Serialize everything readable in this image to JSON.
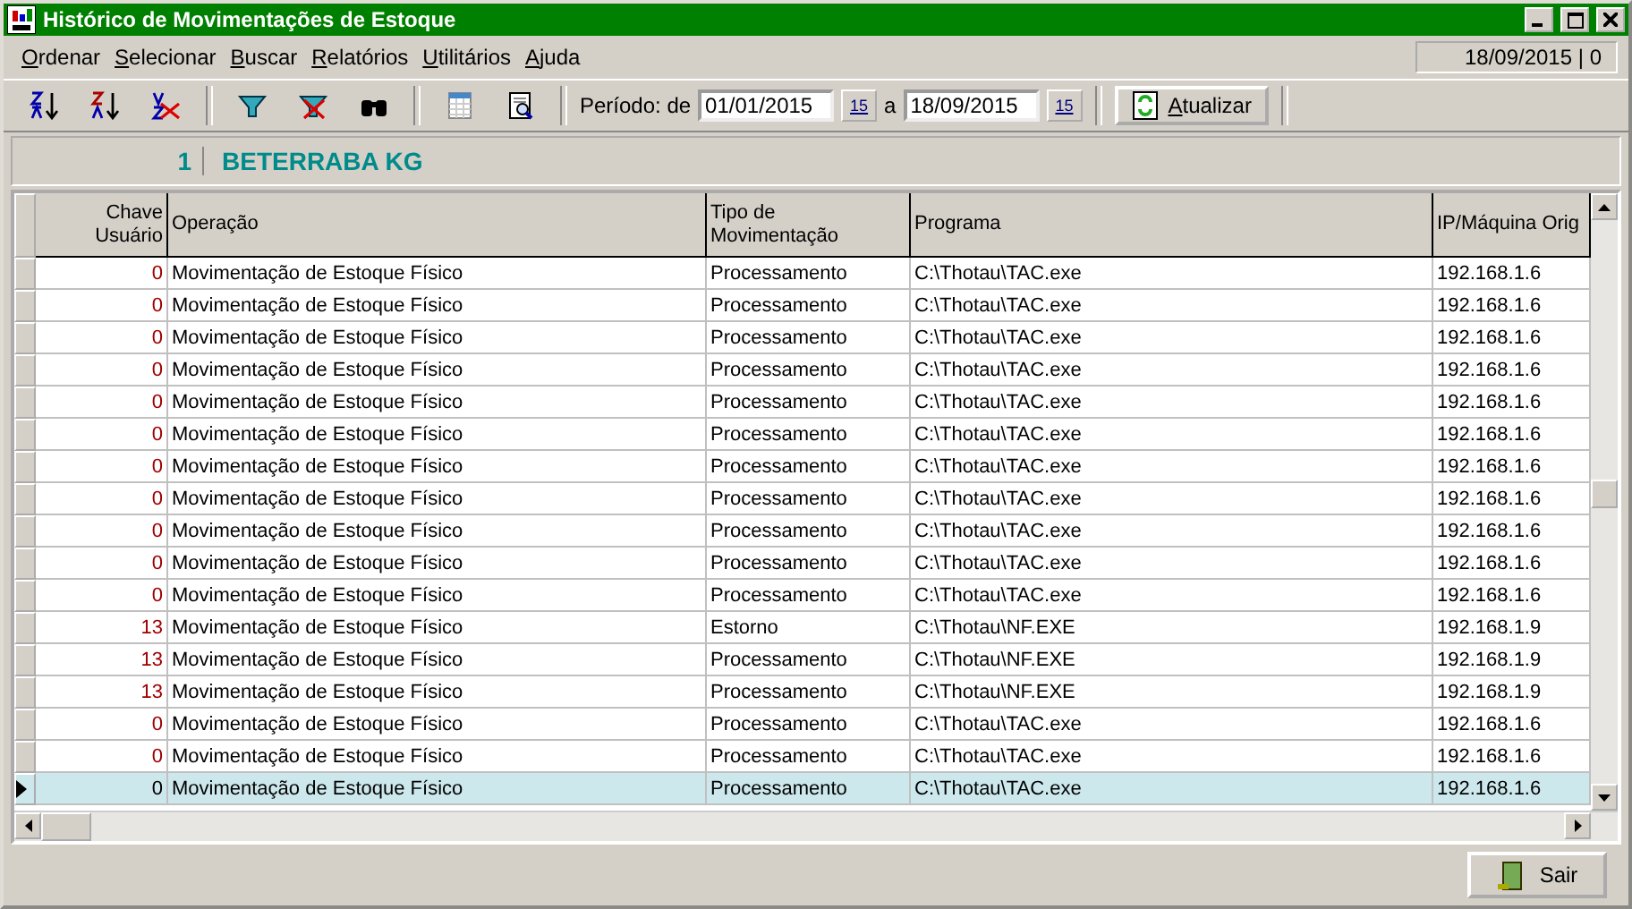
{
  "window": {
    "title": "Histórico de Movimentações de Estoque"
  },
  "menu": [
    "Ordenar",
    "Selecionar",
    "Buscar",
    "Relatórios",
    "Utilitários",
    "Ajuda"
  ],
  "status": "18/09/2015 | 0",
  "toolbar": {
    "period_label": "Período: de",
    "from": "01/01/2015",
    "from_calendar": "15",
    "to_calendar": "15",
    "to_label": "a",
    "to": "18/09/2015",
    "refresh": "Atualizar"
  },
  "product": {
    "code": "1",
    "name": "BETERRABA KG"
  },
  "table": {
    "columns": [
      "Chave Usuário",
      "Operação",
      "Tipo de Movimentação",
      "Programa",
      "IP/Máquina Orig"
    ],
    "rows": [
      {
        "user_key": "0",
        "operation": "Movimentação de Estoque Físico",
        "type": "Processamento",
        "program": "C:\\Thotau\\TAC.exe",
        "ip": "192.168.1.6",
        "selected": false
      },
      {
        "user_key": "0",
        "operation": "Movimentação de Estoque Físico",
        "type": "Processamento",
        "program": "C:\\Thotau\\TAC.exe",
        "ip": "192.168.1.6",
        "selected": false
      },
      {
        "user_key": "0",
        "operation": "Movimentação de Estoque Físico",
        "type": "Processamento",
        "program": "C:\\Thotau\\TAC.exe",
        "ip": "192.168.1.6",
        "selected": false
      },
      {
        "user_key": "0",
        "operation": "Movimentação de Estoque Físico",
        "type": "Processamento",
        "program": "C:\\Thotau\\TAC.exe",
        "ip": "192.168.1.6",
        "selected": false
      },
      {
        "user_key": "0",
        "operation": "Movimentação de Estoque Físico",
        "type": "Processamento",
        "program": "C:\\Thotau\\TAC.exe",
        "ip": "192.168.1.6",
        "selected": false
      },
      {
        "user_key": "0",
        "operation": "Movimentação de Estoque Físico",
        "type": "Processamento",
        "program": "C:\\Thotau\\TAC.exe",
        "ip": "192.168.1.6",
        "selected": false
      },
      {
        "user_key": "0",
        "operation": "Movimentação de Estoque Físico",
        "type": "Processamento",
        "program": "C:\\Thotau\\TAC.exe",
        "ip": "192.168.1.6",
        "selected": false
      },
      {
        "user_key": "0",
        "operation": "Movimentação de Estoque Físico",
        "type": "Processamento",
        "program": "C:\\Thotau\\TAC.exe",
        "ip": "192.168.1.6",
        "selected": false
      },
      {
        "user_key": "0",
        "operation": "Movimentação de Estoque Físico",
        "type": "Processamento",
        "program": "C:\\Thotau\\TAC.exe",
        "ip": "192.168.1.6",
        "selected": false
      },
      {
        "user_key": "0",
        "operation": "Movimentação de Estoque Físico",
        "type": "Processamento",
        "program": "C:\\Thotau\\TAC.exe",
        "ip": "192.168.1.6",
        "selected": false
      },
      {
        "user_key": "0",
        "operation": "Movimentação de Estoque Físico",
        "type": "Processamento",
        "program": "C:\\Thotau\\TAC.exe",
        "ip": "192.168.1.6",
        "selected": false
      },
      {
        "user_key": "13",
        "operation": "Movimentação de Estoque Físico",
        "type": "Estorno",
        "program": "C:\\Thotau\\NF.EXE",
        "ip": "192.168.1.9",
        "selected": false
      },
      {
        "user_key": "13",
        "operation": "Movimentação de Estoque Físico",
        "type": "Processamento",
        "program": "C:\\Thotau\\NF.EXE",
        "ip": "192.168.1.9",
        "selected": false
      },
      {
        "user_key": "13",
        "operation": "Movimentação de Estoque Físico",
        "type": "Processamento",
        "program": "C:\\Thotau\\NF.EXE",
        "ip": "192.168.1.9",
        "selected": false
      },
      {
        "user_key": "0",
        "operation": "Movimentação de Estoque Físico",
        "type": "Processamento",
        "program": "C:\\Thotau\\TAC.exe",
        "ip": "192.168.1.6",
        "selected": false
      },
      {
        "user_key": "0",
        "operation": "Movimentação de Estoque Físico",
        "type": "Processamento",
        "program": "C:\\Thotau\\TAC.exe",
        "ip": "192.168.1.6",
        "selected": false
      },
      {
        "user_key": "0",
        "operation": "Movimentação de Estoque Físico",
        "type": "Processamento",
        "program": "C:\\Thotau\\TAC.exe",
        "ip": "192.168.1.6",
        "selected": true
      }
    ]
  },
  "exit_button": "Sair"
}
